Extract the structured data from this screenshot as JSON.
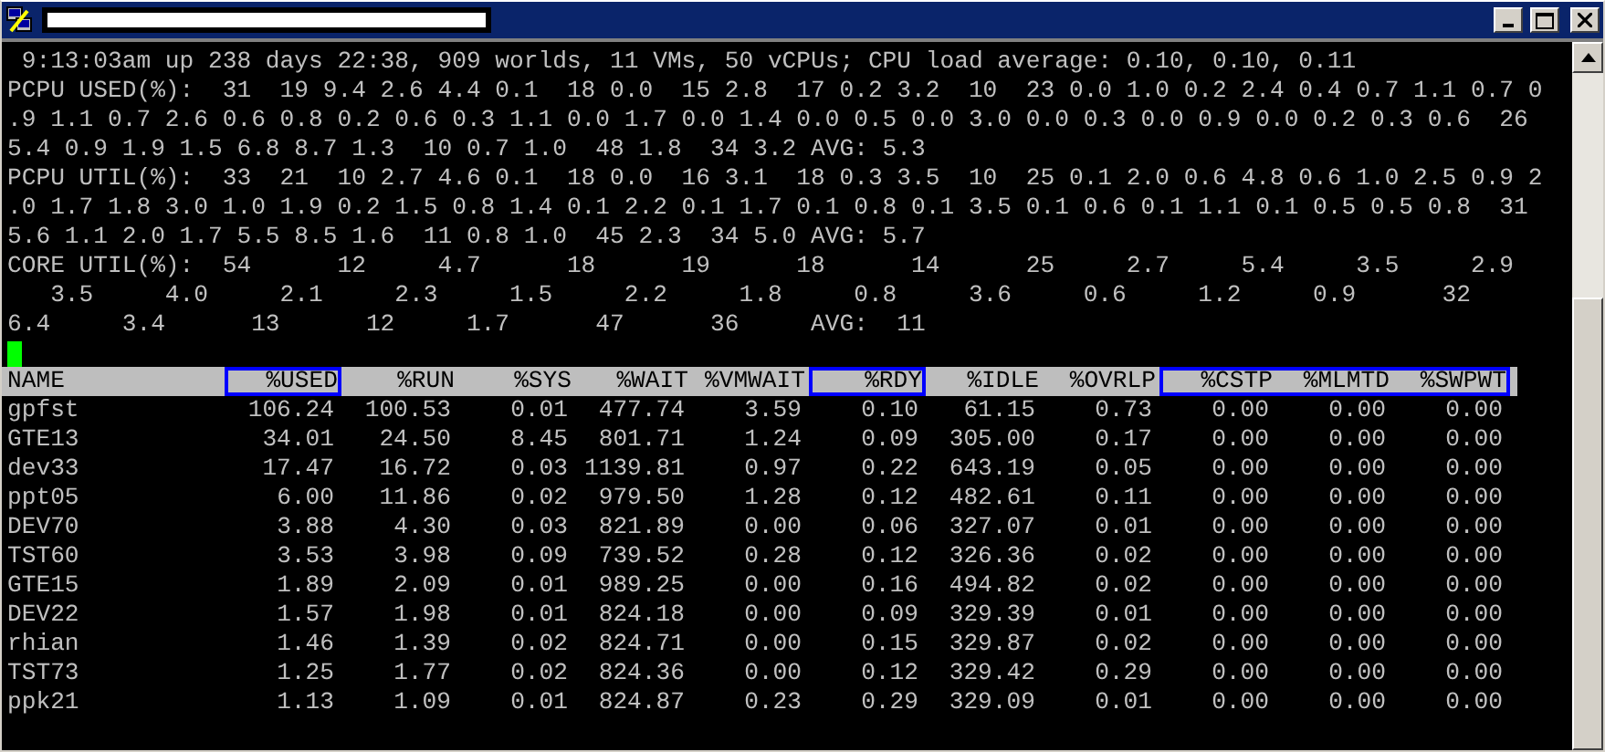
{
  "terminal": {
    "lines": [
      " 9:13:03am up 238 days 22:38, 909 worlds, 11 VMs, 50 vCPUs; CPU load average: 0.10, 0.10, 0.11",
      "PCPU USED(%):  31  19 9.4 2.6 4.4 0.1  18 0.0  15 2.8  17 0.2 3.2  10  23 0.0 1.0 0.2 2.4 0.4 0.7 1.1 0.7 0",
      ".9 1.1 0.7 2.6 0.6 0.8 0.2 0.6 0.3 1.1 0.0 1.7 0.0 1.4 0.0 0.5 0.0 3.0 0.0 0.3 0.0 0.9 0.0 0.2 0.3 0.6  26",
      "5.4 0.9 1.9 1.5 6.8 8.7 1.3  10 0.7 1.0  48 1.8  34 3.2 AVG: 5.3",
      "PCPU UTIL(%):  33  21  10 2.7 4.6 0.1  18 0.0  16 3.1  18 0.3 3.5  10  25 0.1 2.0 0.6 4.8 0.6 1.0 2.5 0.9 2",
      ".0 1.7 1.8 3.0 1.0 1.9 0.2 1.5 0.8 1.4 0.1 2.2 0.1 1.7 0.1 0.8 0.1 3.5 0.1 0.6 0.1 1.1 0.1 0.5 0.5 0.8  31",
      "5.6 1.1 2.0 1.7 5.5 8.5 1.6  11 0.8 1.0  45 2.3  34 5.0 AVG: 5.7",
      "CORE UTIL(%):  54      12     4.7      18      19      18      14      25     2.7     5.4     3.5     2.9",
      "   3.5     4.0     2.1     2.3     1.5     2.2     1.8     0.8     3.6     0.6     1.2     0.9      32",
      "6.4     3.4      13      12     1.7      47      36     AVG:  11"
    ],
    "table": {
      "columns": [
        {
          "label": "NAME",
          "highlighted": false
        },
        {
          "label": "%USED",
          "highlighted": true
        },
        {
          "label": "%RUN",
          "highlighted": false
        },
        {
          "label": "%SYS",
          "highlighted": false
        },
        {
          "label": "%WAIT",
          "highlighted": false
        },
        {
          "label": "%VMWAIT",
          "highlighted": false
        },
        {
          "label": "%RDY",
          "highlighted": true
        },
        {
          "label": "%IDLE",
          "highlighted": false
        },
        {
          "label": "%OVRLP",
          "highlighted": false
        },
        {
          "label": "%CSTP",
          "highlighted": true
        },
        {
          "label": "%MLMTD",
          "highlighted": true
        },
        {
          "label": "%SWPWT",
          "highlighted": true
        }
      ],
      "rows": [
        [
          "gpfst",
          "106.24",
          "100.53",
          "0.01",
          "477.74",
          "3.59",
          "0.10",
          "61.15",
          "0.73",
          "0.00",
          "0.00",
          "0.00"
        ],
        [
          "GTE13",
          "34.01",
          "24.50",
          "8.45",
          "801.71",
          "1.24",
          "0.09",
          "305.00",
          "0.17",
          "0.00",
          "0.00",
          "0.00"
        ],
        [
          "dev33",
          "17.47",
          "16.72",
          "0.03",
          "1139.81",
          "0.97",
          "0.22",
          "643.19",
          "0.05",
          "0.00",
          "0.00",
          "0.00"
        ],
        [
          "ppt05",
          "6.00",
          "11.86",
          "0.02",
          "979.50",
          "1.28",
          "0.12",
          "482.61",
          "0.11",
          "0.00",
          "0.00",
          "0.00"
        ],
        [
          "DEV70",
          "3.88",
          "4.30",
          "0.03",
          "821.89",
          "0.00",
          "0.06",
          "327.07",
          "0.01",
          "0.00",
          "0.00",
          "0.00"
        ],
        [
          "TST60",
          "3.53",
          "3.98",
          "0.09",
          "739.52",
          "0.28",
          "0.12",
          "326.36",
          "0.02",
          "0.00",
          "0.00",
          "0.00"
        ],
        [
          "GTE15",
          "1.89",
          "2.09",
          "0.01",
          "989.25",
          "0.00",
          "0.16",
          "494.82",
          "0.02",
          "0.00",
          "0.00",
          "0.00"
        ],
        [
          "DEV22",
          "1.57",
          "1.98",
          "0.01",
          "824.18",
          "0.00",
          "0.09",
          "329.39",
          "0.01",
          "0.00",
          "0.00",
          "0.00"
        ],
        [
          "rhian",
          "1.46",
          "1.39",
          "0.02",
          "824.71",
          "0.00",
          "0.15",
          "329.87",
          "0.02",
          "0.00",
          "0.00",
          "0.00"
        ],
        [
          "TST73",
          "1.25",
          "1.77",
          "0.02",
          "824.36",
          "0.00",
          "0.12",
          "329.42",
          "0.29",
          "0.00",
          "0.00",
          "0.00"
        ],
        [
          "ppk21",
          "1.13",
          "1.09",
          "0.01",
          "824.87",
          "0.23",
          "0.29",
          "329.09",
          "0.01",
          "0.00",
          "0.00",
          "0.00"
        ]
      ]
    }
  }
}
